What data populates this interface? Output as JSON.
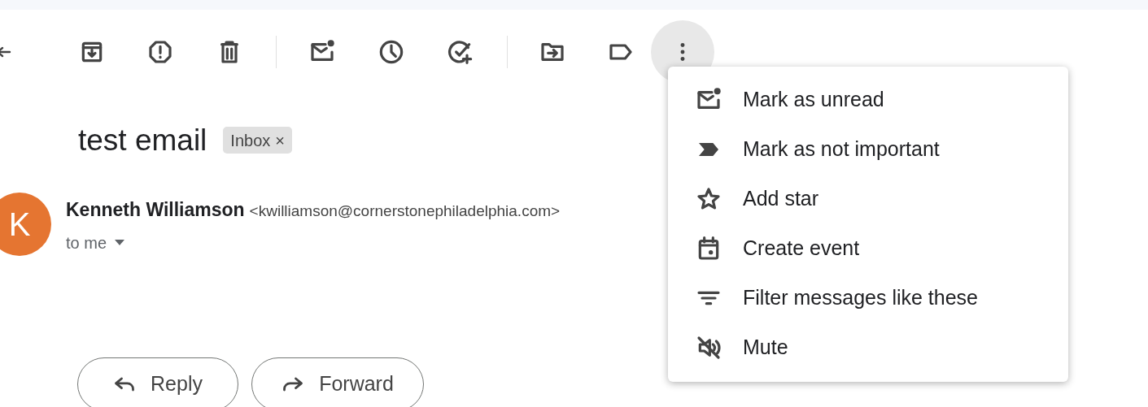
{
  "toolbar": {
    "more_button": {
      "active": true
    }
  },
  "subject": {
    "title": "test email",
    "label_chip": {
      "text": "Inbox",
      "remove": "×"
    }
  },
  "message": {
    "avatar_letter": "K",
    "sender_name": "Kenneth Williamson",
    "sender_email": "<kwilliamson@cornerstonephiladelphia.com>",
    "recipients": "to me"
  },
  "actions": [
    {
      "label": "Reply"
    },
    {
      "label": "Forward"
    }
  ],
  "menu": {
    "items": [
      {
        "label": "Mark as unread"
      },
      {
        "label": "Mark as not important"
      },
      {
        "label": "Add star"
      },
      {
        "label": "Create event"
      },
      {
        "label": "Filter messages like these"
      },
      {
        "label": "Mute"
      }
    ]
  }
}
